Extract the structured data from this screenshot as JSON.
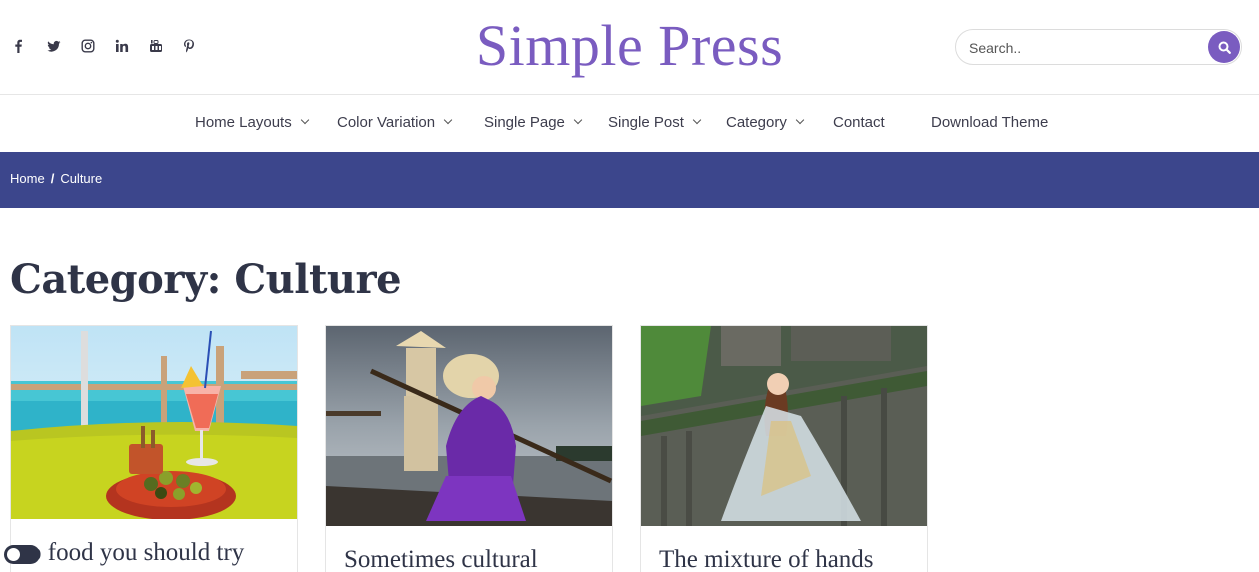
{
  "brand": {
    "title": "Simple Press",
    "color": "#7a5cc0"
  },
  "social": [
    {
      "name": "facebook-icon"
    },
    {
      "name": "twitter-icon"
    },
    {
      "name": "instagram-icon"
    },
    {
      "name": "linkedin-icon"
    },
    {
      "name": "youtube-icon"
    },
    {
      "name": "pinterest-icon"
    }
  ],
  "search": {
    "placeholder": "Search..",
    "button_icon": "search-icon"
  },
  "nav": {
    "items": [
      {
        "label": "Home Layouts",
        "dropdown": true
      },
      {
        "label": "Color Variation",
        "dropdown": true
      },
      {
        "label": "Single Page",
        "dropdown": true
      },
      {
        "label": "Single Post",
        "dropdown": true
      },
      {
        "label": "Category",
        "dropdown": true
      },
      {
        "label": "Contact",
        "dropdown": false
      },
      {
        "label": "Download Theme",
        "dropdown": false
      }
    ]
  },
  "breadcrumb": {
    "home": "Home",
    "separator": "/",
    "current": "Culture",
    "band_color": "#3c468c"
  },
  "page": {
    "title": "Category: Culture"
  },
  "cards": [
    {
      "title": "...so food you should try",
      "visible_title": "o food you should try"
    },
    {
      "title": "Sometimes cultural"
    },
    {
      "title": "The mixture of hands"
    }
  ],
  "theme_toggle": {
    "icon": "dark-mode-toggle"
  }
}
